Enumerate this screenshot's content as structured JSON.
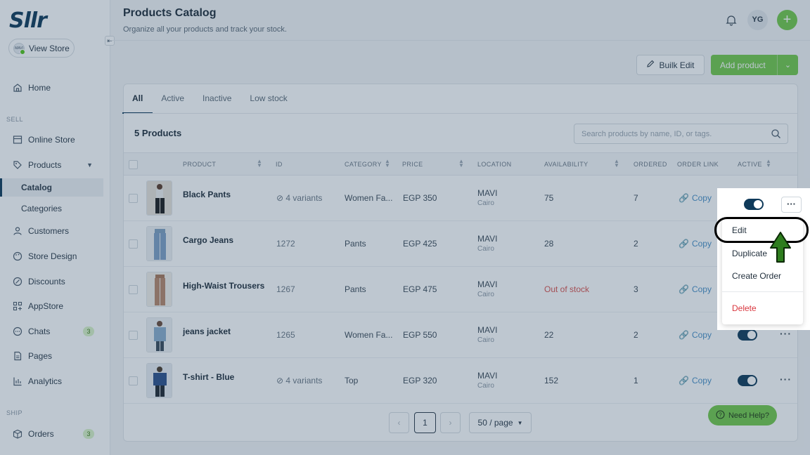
{
  "brand": {
    "logo": "Sllr"
  },
  "sidebar": {
    "view_store": "View Store",
    "store_dot": "MAVI",
    "home": "Home",
    "section_sell": "SELL",
    "online_store": "Online Store",
    "products": "Products",
    "catalog": "Catalog",
    "categories": "Categories",
    "customers": "Customers",
    "store_design": "Store Design",
    "discounts": "Discounts",
    "appstore": "AppStore",
    "chats": "Chats",
    "chats_badge": "3",
    "pages": "Pages",
    "analytics": "Analytics",
    "section_ship": "SHIP",
    "orders": "Orders",
    "orders_badge": "3"
  },
  "header": {
    "title": "Products Catalog",
    "subtitle": "Organize all your products and track your stock.",
    "avatar": "YG",
    "plus": "+"
  },
  "toolbar": {
    "bulk_edit": "Builk Edit",
    "add_product": "Add product"
  },
  "tabs": [
    "All",
    "Active",
    "Inactive",
    "Low stock"
  ],
  "list": {
    "count": "5 Products",
    "search_placeholder": "Search products by name, ID, or tags."
  },
  "columns": {
    "product": "PRODUCT",
    "id": "ID",
    "category": "CATEGORY",
    "price": "PRICE",
    "location": "LOCATION",
    "availability": "AVAILABILITY",
    "ordered": "ORDERED",
    "order_link": "ORDER LINK",
    "active": "ACTIVE"
  },
  "rows": [
    {
      "name": "Black Pants",
      "id": "4 variants",
      "category": "Women Fa...",
      "price": "EGP 350",
      "location": "MAVI",
      "city": "Cairo",
      "availability": "75",
      "ordered": "7",
      "link": "Copy"
    },
    {
      "name": "Cargo Jeans",
      "id": "1272",
      "category": "Pants",
      "price": "EGP 425",
      "location": "MAVI",
      "city": "Cairo",
      "availability": "28",
      "ordered": "2",
      "link": "Copy"
    },
    {
      "name": "High-Waist Trousers",
      "id": "1267",
      "category": "Pants",
      "price": "EGP 475",
      "location": "MAVI",
      "city": "Cairo",
      "availability": "Out of stock",
      "ordered": "3",
      "link": "Copy"
    },
    {
      "name": "jeans jacket",
      "id": "1265",
      "category": "Women Fa...",
      "price": "EGP 550",
      "location": "MAVI",
      "city": "Cairo",
      "availability": "22",
      "ordered": "2",
      "link": "Copy"
    },
    {
      "name": "T-shirt - Blue",
      "id": "4 variants",
      "category": "Top",
      "price": "EGP 320",
      "location": "MAVI",
      "city": "Cairo",
      "availability": "152",
      "ordered": "1",
      "link": "Copy"
    }
  ],
  "pagination": {
    "page": "1",
    "per_page": "50 / page"
  },
  "help": "Need Help?",
  "context_menu": {
    "edit": "Edit",
    "duplicate": "Duplicate",
    "create_order": "Create Order",
    "delete": "Delete"
  },
  "colors": {
    "brand": "#0f3a5a",
    "accent": "#72c94a",
    "danger": "#d9363e",
    "link": "#4a90c6"
  }
}
